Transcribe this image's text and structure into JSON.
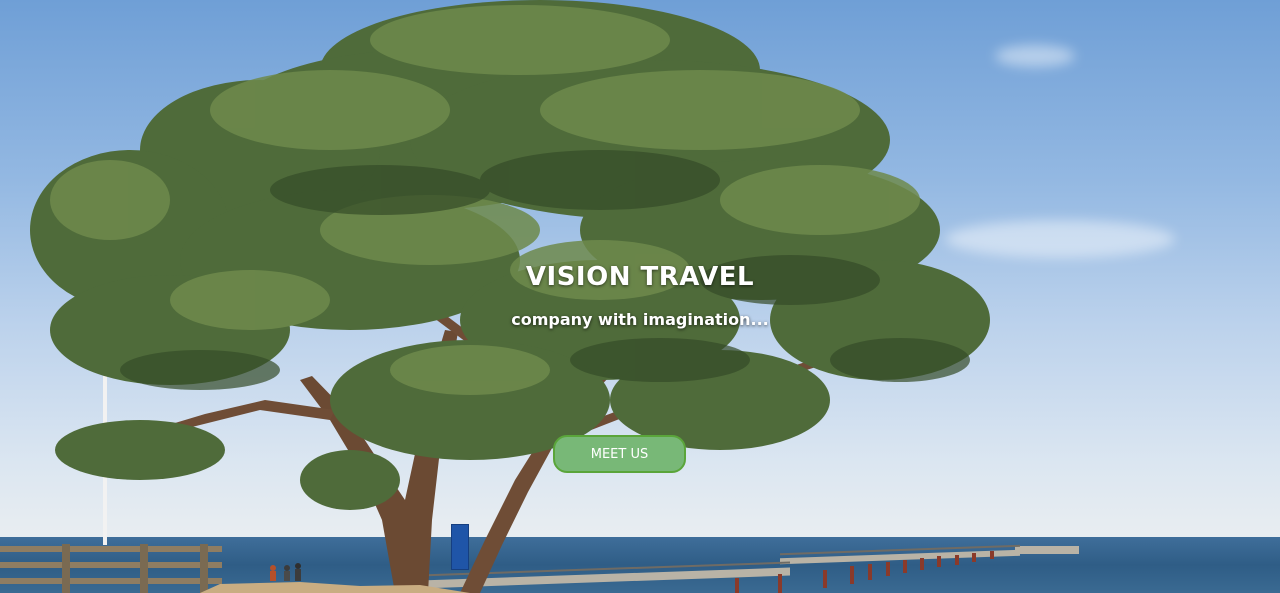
{
  "hero": {
    "title": "VISION TRAVEL",
    "subtitle": "company with imagination...",
    "cta_label": "MEET US",
    "background_description": "pine tree on beach with pier and sea",
    "colors": {
      "cta_fill": "#78b877",
      "cta_border": "#5aa53a",
      "sky_top": "#6f9fd6",
      "sea": "#2f5d86"
    }
  }
}
